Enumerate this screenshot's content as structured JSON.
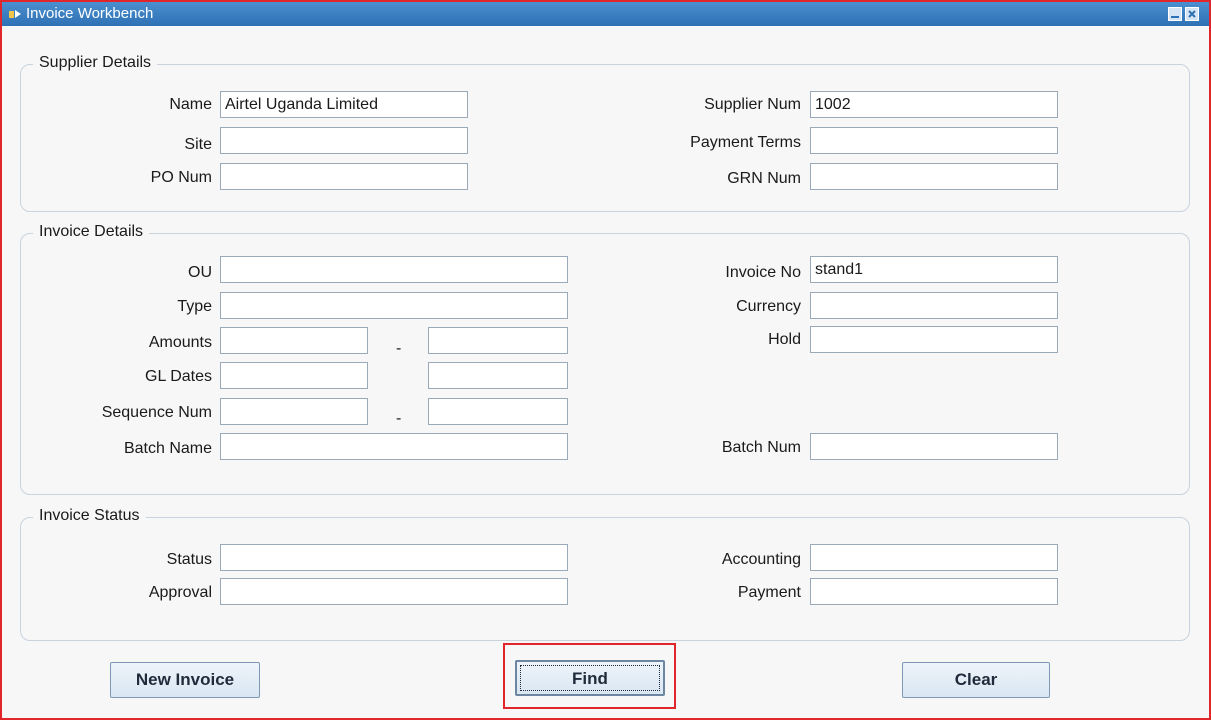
{
  "window": {
    "title": "Invoice Workbench"
  },
  "supplier_details": {
    "title": "Supplier Details",
    "name_label": "Name",
    "name_value": "Airtel Uganda Limited",
    "site_label": "Site",
    "site_value": "",
    "po_num_label": "PO Num",
    "po_num_value": "",
    "supplier_num_label": "Supplier Num",
    "supplier_num_value": "1002",
    "payment_terms_label": "Payment Terms",
    "payment_terms_value": "",
    "grn_num_label": "GRN Num",
    "grn_num_value": ""
  },
  "invoice_details": {
    "title": "Invoice Details",
    "ou_label": "OU",
    "ou_value": "",
    "type_label": "Type",
    "type_value": "",
    "amounts_label": "Amounts",
    "amounts_from": "",
    "amounts_to": "",
    "range_separator": "-",
    "gl_dates_label": "GL Dates",
    "gl_dates_from": "",
    "gl_dates_to": "",
    "sequence_num_label": "Sequence Num",
    "sequence_num_from": "",
    "sequence_num_to": "",
    "batch_name_label": "Batch Name",
    "batch_name_value": "",
    "invoice_no_label": "Invoice No",
    "invoice_no_value": "stand1",
    "currency_label": "Currency",
    "currency_value": "",
    "hold_label": "Hold",
    "hold_value": "",
    "batch_num_label": "Batch Num",
    "batch_num_value": ""
  },
  "invoice_status": {
    "title": "Invoice Status",
    "status_label": "Status",
    "status_value": "",
    "approval_label": "Approval",
    "approval_value": "",
    "accounting_label": "Accounting",
    "accounting_value": "",
    "payment_label": "Payment",
    "payment_value": ""
  },
  "buttons": {
    "new_invoice": "New Invoice",
    "find": "Find",
    "clear": "Clear"
  },
  "colors": {
    "titlebar": "#2e71b5",
    "highlight": "#e0262b",
    "button_bg": "#d9e6f2"
  },
  "icons": {
    "app": "oracle-forms-icon",
    "minimize": "minimize-icon",
    "close": "close-icon"
  }
}
